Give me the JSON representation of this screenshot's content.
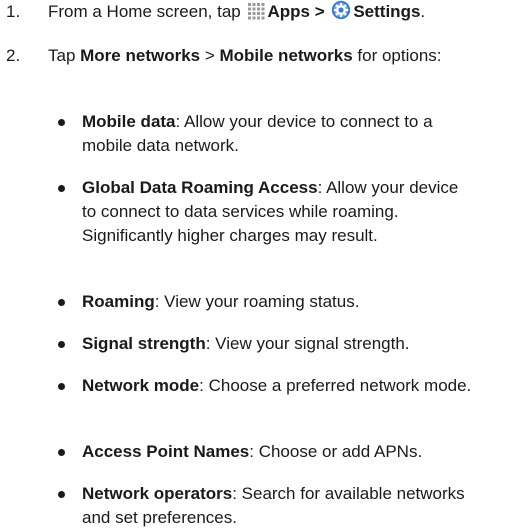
{
  "step1": {
    "number": "1.",
    "prefix": "From a Home screen, tap ",
    "apps_icon": "apps-grid-icon",
    "apps_label": "Apps",
    "separator": " > ",
    "settings_icon": "settings-gear-icon",
    "settings_label": "Settings",
    "suffix": "."
  },
  "step2": {
    "number": "2.",
    "prefix": "Tap ",
    "more_networks": "More networks",
    "separator": " > ",
    "mobile_networks": "Mobile networks",
    "suffix": " for options:"
  },
  "options": [
    {
      "term": "Mobile data",
      "desc": ": Allow your device to connect to a mobile data network."
    },
    {
      "term": "Global Data Roaming Access",
      "desc": ": Allow your device to connect to data services while roaming. Significantly higher charges may result."
    },
    {
      "term": "Roaming",
      "desc": ": View your roaming status."
    },
    {
      "term": "Signal strength",
      "desc": ": View your signal strength."
    },
    {
      "term": "Network mode",
      "desc": ": Choose a preferred network mode."
    },
    {
      "term": "Access Point Names",
      "desc": ": Choose or add APNs."
    },
    {
      "term": "Network operators",
      "desc": ": Search for available networks and set preferences."
    }
  ],
  "colors": {
    "text": "#1a1a1a",
    "settings_icon": "#3b7bd6"
  }
}
